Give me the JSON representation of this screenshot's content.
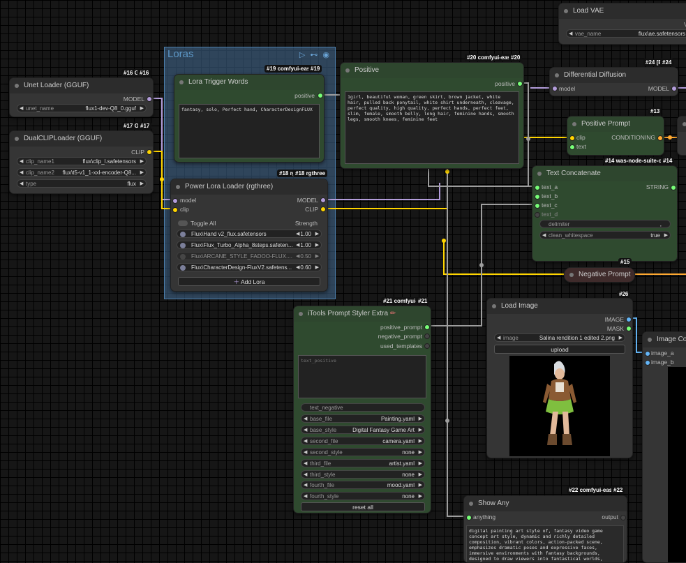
{
  "group": {
    "title": "Loras"
  },
  "nodes": {
    "unet": {
      "badge_a": "#16 G",
      "badge_b": "#16",
      "title": "Unet Loader (GGUF)",
      "output": "MODEL",
      "widgets": [
        {
          "label": "unet_name",
          "value": "flux1-dev-Q8_0.gguf"
        }
      ]
    },
    "dualclip": {
      "badge_a": "#17 G",
      "badge_b": "#17",
      "title": "DualCLIPLoader (GGUF)",
      "output": "CLIP",
      "widgets": [
        {
          "label": "clip_name1",
          "value": "flux\\clip_l.safetensors"
        },
        {
          "label": "clip_name2",
          "value": "flux\\t5-v1_1-xxl-encoder-Q8..."
        },
        {
          "label": "type",
          "value": "flux"
        }
      ]
    },
    "trigger": {
      "badge_a": "#19 comfyui-eas",
      "badge_b": "#19",
      "title": "Lora Trigger Words",
      "output": "positive",
      "text": "fantasy, solo, Perfect hand, CharacterDesignFLUX"
    },
    "powerlora": {
      "badge_a": "#18 rg",
      "badge_b": "#18 rgthree",
      "title": "Power Lora Loader (rgthree)",
      "inputs": [
        "model",
        "clip"
      ],
      "outputs": [
        "MODEL",
        "CLIP"
      ],
      "toggle_all": "Toggle All",
      "strength_header": "Strength",
      "loras": [
        {
          "name": "Flux\\Hand v2_flux.safetensors",
          "strength": "1.00"
        },
        {
          "name": "Flux\\Flux_Turbo_Alpha_8steps.safeten...",
          "strength": "1.00"
        },
        {
          "name": "Flux\\ARCANE_STYLE_FADOO-FLUX....",
          "strength": "0.50"
        },
        {
          "name": "Flux\\CharacterDesign-FluxV2.safetens...",
          "strength": "0.60"
        }
      ],
      "add_label": "Add Lora"
    },
    "positive": {
      "badge_a": "#20 comfyui-eas",
      "badge_b": "#20",
      "title": "Positive",
      "output": "positive",
      "text": "1girl, beautiful woman, green skirt, brown jacket, white hair, pulled back ponytail, white shirt underneath, cleavage, perfect quality, high quality, perfect hands, perfect feet, slim, female, smooth belly, long hair, feminine hands, smooth legs, smooth knees, feminine feet"
    },
    "loadvae": {
      "title": "Load VAE",
      "output": "V",
      "widgets": [
        {
          "label": "vae_name",
          "value": "flux\\ae.safetensors"
        }
      ]
    },
    "diffdiff": {
      "badge_a": "#24 [E",
      "badge_b": "#24",
      "title": "Differential Diffusion",
      "input": "model",
      "output": "MODEL"
    },
    "posprompt": {
      "badge_b": "#13",
      "title": "Positive Prompt",
      "inputs": [
        "clip",
        "text"
      ],
      "output": "CONDITIONING"
    },
    "textconcat": {
      "badge_a": "#14 was-node-suite-co",
      "badge_b": "#14",
      "title": "Text Concatenate",
      "inputs": [
        "text_a",
        "text_b",
        "text_c",
        "text_d"
      ],
      "output": "STRING",
      "widgets": [
        {
          "label": "delimiter",
          "value": ","
        },
        {
          "label": "clean_whitespace",
          "value": "true"
        }
      ]
    },
    "negprompt": {
      "badge_b": "#15",
      "title": "Negative Prompt"
    },
    "itools": {
      "badge_a": "#21 comfyui-",
      "badge_b": "#21",
      "title": "iTools Prompt Styler Extra",
      "title_icon": "✏",
      "outputs": [
        "positive_prompt",
        "negative_prompt",
        "used_templates"
      ],
      "text_positive_placeholder": "text_positive",
      "text_negative": "text_negative",
      "widgets": [
        {
          "label": "base_file",
          "value": "Painting.yaml"
        },
        {
          "label": "base_style",
          "value": "Digital Fantasy Game Art"
        },
        {
          "label": "second_file",
          "value": "camera.yaml"
        },
        {
          "label": "second_style",
          "value": "none"
        },
        {
          "label": "third_file",
          "value": "artist.yaml"
        },
        {
          "label": "third_style",
          "value": "none"
        },
        {
          "label": "fourth_file",
          "value": "mood.yaml"
        },
        {
          "label": "fourth_style",
          "value": "none"
        }
      ],
      "reset_label": "reset all"
    },
    "loadimage": {
      "badge_b": "#26",
      "title": "Load Image",
      "outputs": [
        "IMAGE",
        "MASK"
      ],
      "widget": {
        "label": "image",
        "value": "Salina rendition 1 edited 2.png"
      },
      "upload_label": "upload"
    },
    "imagecomp": {
      "title": "Image Com",
      "inputs": [
        "image_a",
        "image_b"
      ]
    },
    "showany": {
      "badge_a": "#22 comfyui-eas",
      "badge_b": "#22",
      "title": "Show Any",
      "input": "anything",
      "output": "output",
      "text": "digital painting art style of, fantasy video game concept art style, dynamic and richly detailed composition, vibrant colors, action-packed scene, emphasizes dramatic poses and expressive faces, immersive environments with fantasy backgrounds, designed to draw viewers into fantastical worlds, typical for character and environment designs in"
    }
  },
  "colors": {
    "model": "#b39ddb",
    "clip": "#ffd500",
    "conditioning": "#ffa931",
    "string": "#77ff77",
    "image": "#64b5f6",
    "link": "#9e9e9e"
  }
}
